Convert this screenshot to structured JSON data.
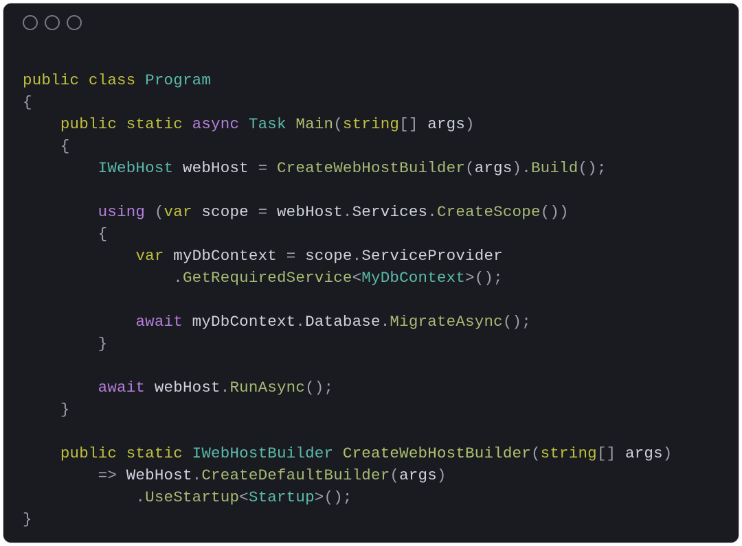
{
  "window": {
    "traffic_lights": [
      "close",
      "minimize",
      "zoom"
    ]
  },
  "code": {
    "tokens": [
      [
        [
          "k",
          "public"
        ],
        [
          " "
        ],
        [
          "k",
          "class"
        ],
        [
          " "
        ],
        [
          "t",
          "Program"
        ]
      ],
      [
        [
          "p",
          "{"
        ]
      ],
      [
        [
          "    "
        ],
        [
          "k",
          "public"
        ],
        [
          " "
        ],
        [
          "k",
          "static"
        ],
        [
          " "
        ],
        [
          "kf",
          "async"
        ],
        [
          " "
        ],
        [
          "t",
          "Task"
        ],
        [
          " "
        ],
        [
          "fn",
          "Main"
        ],
        [
          "p",
          "("
        ],
        [
          "k",
          "string"
        ],
        [
          "p",
          "[]"
        ],
        [
          " "
        ],
        [
          "id",
          "args"
        ],
        [
          "p",
          ")"
        ]
      ],
      [
        [
          "    "
        ],
        [
          "p",
          "{"
        ]
      ],
      [
        [
          "        "
        ],
        [
          "t",
          "IWebHost"
        ],
        [
          " "
        ],
        [
          "id",
          "webHost"
        ],
        [
          " "
        ],
        [
          "p",
          "="
        ],
        [
          " "
        ],
        [
          "m",
          "CreateWebHostBuilder"
        ],
        [
          "p",
          "("
        ],
        [
          "id",
          "args"
        ],
        [
          "p",
          ")"
        ],
        [
          "p",
          "."
        ],
        [
          "m",
          "Build"
        ],
        [
          "p",
          "();"
        ]
      ],
      [
        [
          ""
        ]
      ],
      [
        [
          "        "
        ],
        [
          "kf",
          "using"
        ],
        [
          " "
        ],
        [
          "p",
          "("
        ],
        [
          "k",
          "var"
        ],
        [
          " "
        ],
        [
          "id",
          "scope"
        ],
        [
          " "
        ],
        [
          "p",
          "="
        ],
        [
          " "
        ],
        [
          "id",
          "webHost"
        ],
        [
          "p",
          "."
        ],
        [
          "id",
          "Services"
        ],
        [
          "p",
          "."
        ],
        [
          "m",
          "CreateScope"
        ],
        [
          "p",
          "()"
        ],
        [
          "p",
          ")"
        ]
      ],
      [
        [
          "        "
        ],
        [
          "p",
          "{"
        ]
      ],
      [
        [
          "            "
        ],
        [
          "k",
          "var"
        ],
        [
          " "
        ],
        [
          "id",
          "myDbContext"
        ],
        [
          " "
        ],
        [
          "p",
          "="
        ],
        [
          " "
        ],
        [
          "id",
          "scope"
        ],
        [
          "p",
          "."
        ],
        [
          "id",
          "ServiceProvider"
        ]
      ],
      [
        [
          "                "
        ],
        [
          "p",
          "."
        ],
        [
          "m",
          "GetRequiredService"
        ],
        [
          "p",
          "<"
        ],
        [
          "t",
          "MyDbContext"
        ],
        [
          "p",
          ">"
        ],
        [
          "p",
          "();"
        ]
      ],
      [
        [
          ""
        ]
      ],
      [
        [
          "            "
        ],
        [
          "kf",
          "await"
        ],
        [
          " "
        ],
        [
          "id",
          "myDbContext"
        ],
        [
          "p",
          "."
        ],
        [
          "id",
          "Database"
        ],
        [
          "p",
          "."
        ],
        [
          "m",
          "MigrateAsync"
        ],
        [
          "p",
          "();"
        ]
      ],
      [
        [
          "        "
        ],
        [
          "p",
          "}"
        ]
      ],
      [
        [
          ""
        ]
      ],
      [
        [
          "        "
        ],
        [
          "kf",
          "await"
        ],
        [
          " "
        ],
        [
          "id",
          "webHost"
        ],
        [
          "p",
          "."
        ],
        [
          "m",
          "RunAsync"
        ],
        [
          "p",
          "();"
        ]
      ],
      [
        [
          "    "
        ],
        [
          "p",
          "}"
        ]
      ],
      [
        [
          ""
        ]
      ],
      [
        [
          "    "
        ],
        [
          "k",
          "public"
        ],
        [
          " "
        ],
        [
          "k",
          "static"
        ],
        [
          " "
        ],
        [
          "t",
          "IWebHostBuilder"
        ],
        [
          " "
        ],
        [
          "fn",
          "CreateWebHostBuilder"
        ],
        [
          "p",
          "("
        ],
        [
          "k",
          "string"
        ],
        [
          "p",
          "[]"
        ],
        [
          " "
        ],
        [
          "id",
          "args"
        ],
        [
          "p",
          ")"
        ]
      ],
      [
        [
          "        "
        ],
        [
          "p",
          "=>"
        ],
        [
          " "
        ],
        [
          "id",
          "WebHost"
        ],
        [
          "p",
          "."
        ],
        [
          "m",
          "CreateDefaultBuilder"
        ],
        [
          "p",
          "("
        ],
        [
          "id",
          "args"
        ],
        [
          "p",
          ")"
        ]
      ],
      [
        [
          "            "
        ],
        [
          "p",
          "."
        ],
        [
          "m",
          "UseStartup"
        ],
        [
          "p",
          "<"
        ],
        [
          "t",
          "Startup"
        ],
        [
          "p",
          ">"
        ],
        [
          "p",
          "();"
        ]
      ],
      [
        [
          "p",
          "}"
        ]
      ]
    ]
  }
}
